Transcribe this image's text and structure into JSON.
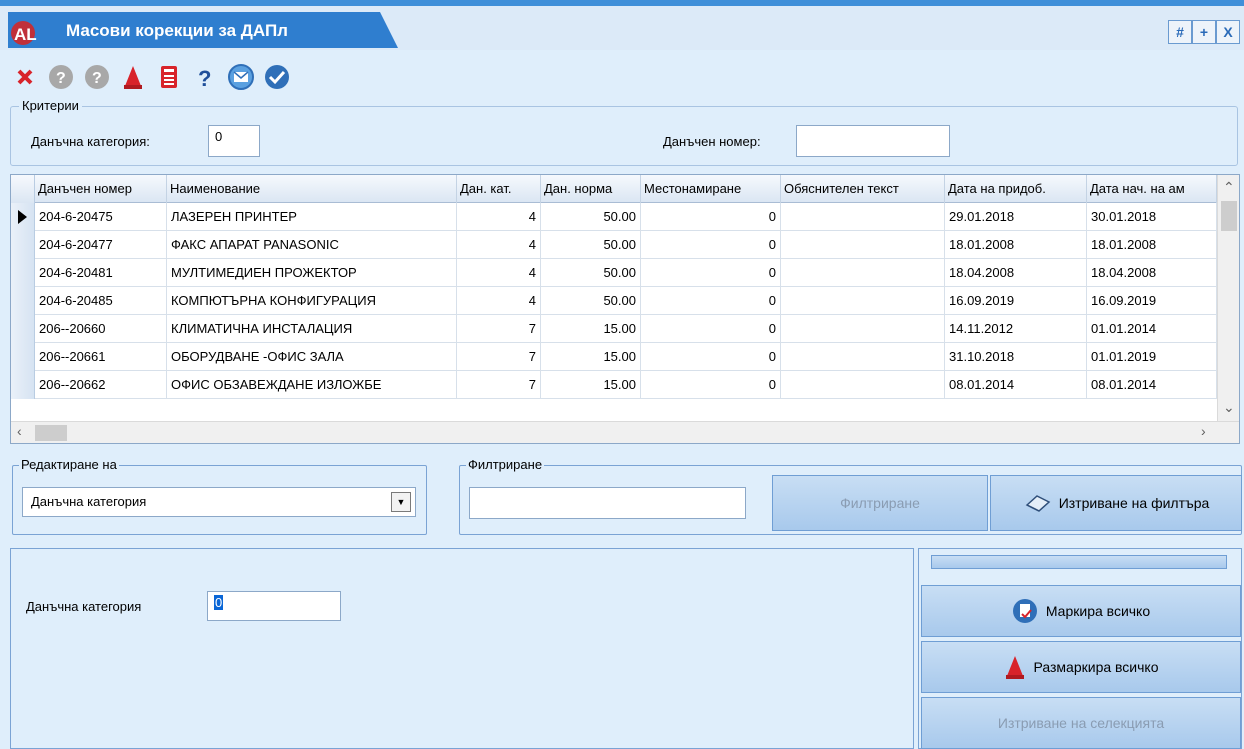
{
  "window": {
    "title": "Масови корекции за ДАПл",
    "controls": [
      "#",
      "+",
      "X"
    ]
  },
  "toolbar": {
    "buttons": [
      "close-icon",
      "help-gray-icon",
      "help-gray-icon",
      "marker-icon",
      "calculator-icon",
      "question-icon",
      "mail-icon",
      "check-icon"
    ]
  },
  "criteria": {
    "legend": "Критерии",
    "tax_category_label": "Данъчна категория:",
    "tax_category_value": "0",
    "tax_number_label": "Данъчен номер:",
    "tax_number_value": ""
  },
  "grid": {
    "columns": [
      "Данъчен номер",
      "Наименование",
      "Дан. кат.",
      "Дан. норма",
      "Местонамиране",
      "Обяснителен текст",
      "Дата на придоб.",
      "Дата нач. на ам"
    ],
    "rows": [
      [
        "204-6-20475",
        "ЛАЗЕРЕН ПРИНТЕР",
        "4",
        "50.00",
        "0",
        "",
        "29.01.2018",
        "30.01.2018"
      ],
      [
        "204-6-20477",
        "ФАКС АПАРАТ PANASONIC",
        "4",
        "50.00",
        "0",
        "",
        "18.01.2008",
        "18.01.2008"
      ],
      [
        "204-6-20481",
        "МУЛТИМЕДИЕН ПРОЖЕКТОР",
        "4",
        "50.00",
        "0",
        "",
        "18.04.2008",
        "18.04.2008"
      ],
      [
        "204-6-20485",
        "КОМПЮТЪРНА КОНФИГУРАЦИЯ",
        "4",
        "50.00",
        "0",
        "",
        "16.09.2019",
        "16.09.2019"
      ],
      [
        "206--20660",
        "КЛИМАТИЧНА ИНСТАЛАЦИЯ",
        "7",
        "15.00",
        "0",
        "",
        "14.11.2012",
        "01.01.2014"
      ],
      [
        "206--20661",
        "ОБОРУДВАНЕ -ОФИС ЗАЛА",
        "7",
        "15.00",
        "0",
        "",
        "31.10.2018",
        "01.01.2019"
      ],
      [
        "206--20662",
        "ОФИС ОБЗАВЕЖДАНЕ ИЗЛОЖБЕ",
        "7",
        "15.00",
        "0",
        "",
        "08.01.2014",
        "08.01.2014"
      ]
    ]
  },
  "edit": {
    "legend": "Редактиране на",
    "selected": "Данъчна категория"
  },
  "filter": {
    "legend": "Филтриране",
    "value": "",
    "filter_button": "Филтриране",
    "clear_button": "Изтриване на филтъра"
  },
  "bottom": {
    "tax_category_label": "Данъчна категория",
    "tax_category_value": "0"
  },
  "actions": {
    "mark_all": "Маркира всичко",
    "unmark_all": "Размаркира всичко",
    "delete_selection": "Изтриване на селекцията"
  }
}
